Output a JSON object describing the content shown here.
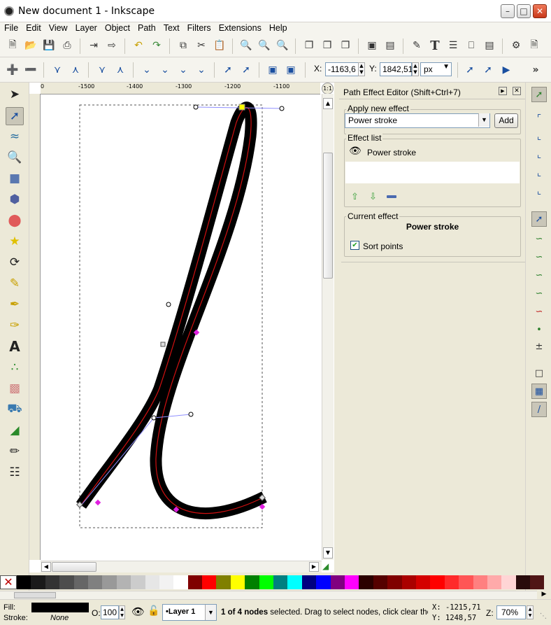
{
  "window": {
    "title": "New document 1 - Inkscape"
  },
  "menu": [
    "File",
    "Edit",
    "View",
    "Layer",
    "Object",
    "Path",
    "Text",
    "Filters",
    "Extensions",
    "Help"
  ],
  "node_toolbar": {
    "x_label": "X:",
    "x_value": "-1163,6",
    "y_label": "Y:",
    "y_value": "1842,51",
    "unit": "px",
    "more": "»"
  },
  "ruler": {
    "ticks": [
      "-1500",
      "-1400",
      "-1300",
      "-1200",
      "-1100"
    ]
  },
  "panel": {
    "title": "Path Effect Editor (Shift+Ctrl+7)",
    "apply_new_effect_label": "Apply new effect",
    "effect_select_value": "Power stroke",
    "add_button": "Add",
    "effect_list_label": "Effect list",
    "effect_list_items": [
      "Power stroke"
    ],
    "current_effect_label": "Current effect",
    "current_effect_name": "Power stroke",
    "sort_points_label": "Sort points",
    "sort_points_checked": true
  },
  "palette_colors": [
    "#000000",
    "#1a1a1a",
    "#333333",
    "#4d4d4d",
    "#666666",
    "#808080",
    "#999999",
    "#b3b3b3",
    "#cccccc",
    "#e6e6e6",
    "#f2f2f2",
    "#ffffff",
    "#800000",
    "#ff0000",
    "#808000",
    "#ffff00",
    "#008000",
    "#00ff00",
    "#008080",
    "#00ffff",
    "#000080",
    "#0000ff",
    "#800080",
    "#ff00ff",
    "#2b0000",
    "#550000",
    "#800000",
    "#aa0000",
    "#d40000",
    "#ff0000",
    "#ff2a2a",
    "#ff5555",
    "#ff8080",
    "#ffaaaa",
    "#ffd5d5",
    "#280b0b",
    "#501616"
  ],
  "status": {
    "fill_label": "Fill:",
    "stroke_label": "Stroke:",
    "stroke_value": "None",
    "opacity_label": "O:",
    "opacity_value": "100",
    "layer_value": "•Layer 1",
    "message_bold": "1 of 4 nodes",
    "message_rest": " selected. Drag to select nodes, click clear the s.",
    "cursor_x": "X: -1215,71",
    "cursor_y": "Y:  1248,57",
    "zoom_label": "Z:",
    "zoom_value": "70%"
  }
}
